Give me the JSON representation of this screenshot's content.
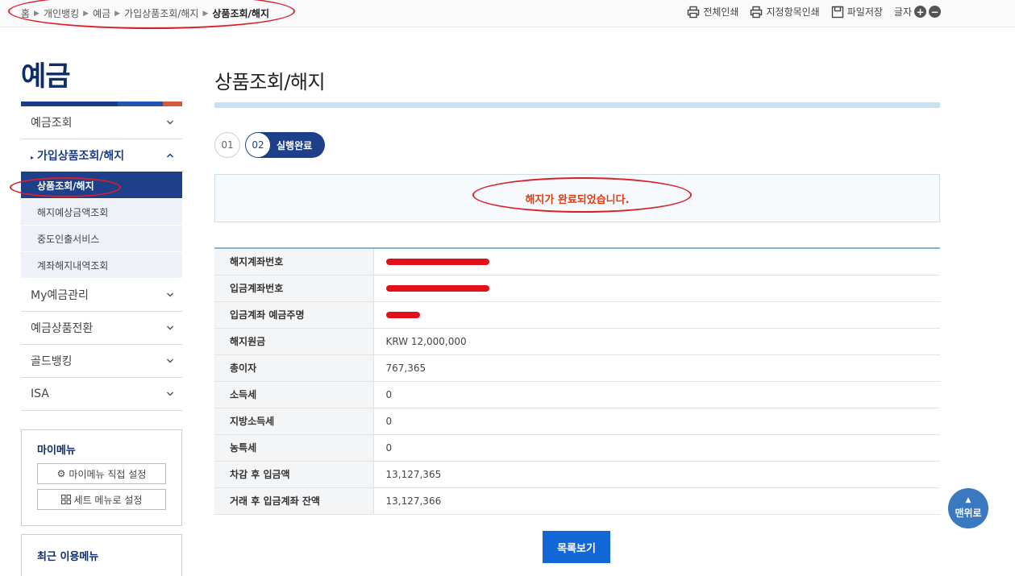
{
  "breadcrumb": [
    "홈",
    "개인뱅킹",
    "예금",
    "가입상품조회/해지",
    "상품조회/해지"
  ],
  "top_actions": {
    "print_all": "전체인쇄",
    "print_selected": "지정항목인쇄",
    "save_file": "파일저장",
    "font_size": "글자"
  },
  "sidebar": {
    "title": "예금",
    "items": [
      {
        "label": "예금조회"
      },
      {
        "label": "가입상품조회/해지"
      },
      {
        "label": "My예금관리"
      },
      {
        "label": "예금상품전환"
      },
      {
        "label": "골드뱅킹"
      },
      {
        "label": "ISA"
      }
    ],
    "sub_items": [
      {
        "label": "상품조회/해지"
      },
      {
        "label": "해지예상금액조회"
      },
      {
        "label": "중도인출서비스"
      },
      {
        "label": "계좌해지내역조회"
      }
    ]
  },
  "my_menu": {
    "title": "마이메뉴",
    "direct_setting": "마이메뉴 직접 설정",
    "set_menu_setting": "세트 메뉴로 설정"
  },
  "recent_menu": {
    "title": "최근 이용메뉴"
  },
  "main": {
    "title": "상품조회/해지",
    "steps": [
      {
        "num": "01"
      },
      {
        "num": "02",
        "label": "실행완료"
      }
    ],
    "result_message": "해지가 완료되었습니다.",
    "rows": [
      {
        "label": "해지계좌번호",
        "value": ""
      },
      {
        "label": "입금계좌번호",
        "value": ""
      },
      {
        "label": "입금계좌 예금주명",
        "value": ""
      },
      {
        "label": "해지원금",
        "value": "KRW 12,000,000"
      },
      {
        "label": "총이자",
        "value": "767,365"
      },
      {
        "label": "소득세",
        "value": "0"
      },
      {
        "label": "지방소득세",
        "value": "0"
      },
      {
        "label": "농특세",
        "value": "0"
      },
      {
        "label": "차감 후 입금액",
        "value": "13,127,365"
      },
      {
        "label": "거래 후 입금계좌 잔액",
        "value": "13,127,366"
      }
    ],
    "list_button": "목록보기"
  },
  "scroll_top": "맨위로",
  "colors": {
    "brand_navy": "#1e3f8a",
    "primary_button": "#1267d6",
    "result_text": "#e03a10",
    "annotation_red": "#d8202a"
  }
}
